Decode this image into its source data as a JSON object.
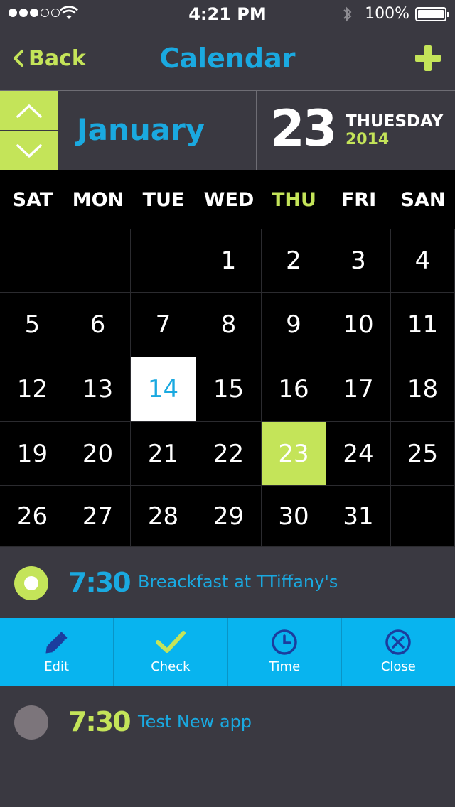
{
  "status_bar": {
    "time": "4:21 PM",
    "battery": "100%",
    "signal_icon": "signal-dots-icon",
    "wifi_icon": "wifi-icon",
    "bluetooth_icon": "bluetooth-icon"
  },
  "nav": {
    "back_label": "Back",
    "title": "Calendar",
    "add_icon": "plus-icon"
  },
  "header": {
    "month": "January",
    "day": "23",
    "weekday": "THUESDAY",
    "year": "2014"
  },
  "calendar": {
    "weekdays": [
      "SAT",
      "MON",
      "TUE",
      "WED",
      "THU",
      "FRI",
      "SAN"
    ],
    "highlight_weekday": "THU",
    "weeks": [
      [
        "",
        "",
        "",
        "1",
        "2",
        "3",
        "4"
      ],
      [
        "5",
        "6",
        "7",
        "8",
        "9",
        "10",
        "11"
      ],
      [
        "12",
        "13",
        "14",
        "15",
        "16",
        "17",
        "18"
      ],
      [
        "19",
        "20",
        "21",
        "22",
        "23",
        "24",
        "25"
      ],
      [
        "26",
        "27",
        "28",
        "29",
        "30",
        "31",
        ""
      ]
    ],
    "selected_day": "14",
    "today": "23"
  },
  "events": [
    {
      "time": "7:30",
      "title": "Breackfast at TTiffany's"
    },
    {
      "time": "7:30",
      "title": "Test New app"
    }
  ],
  "actions": [
    {
      "label": "Edit",
      "icon": "pencil-icon"
    },
    {
      "label": "Check",
      "icon": "checkmark-icon"
    },
    {
      "label": "Time",
      "icon": "clock-icon"
    },
    {
      "label": "Close",
      "icon": "close-circle-icon"
    }
  ],
  "colors": {
    "background": "#3a3941",
    "accent_green": "#c4e459",
    "accent_blue": "#1aa9e0",
    "action_bar": "#08b4ef",
    "grid": "#000000"
  }
}
